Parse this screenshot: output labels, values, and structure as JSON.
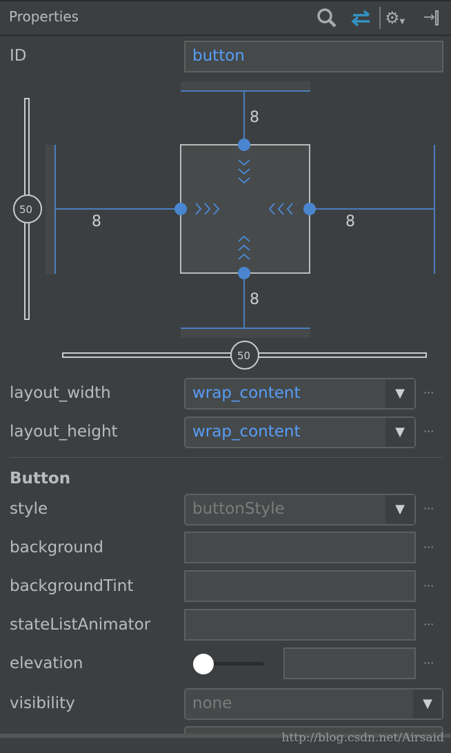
{
  "header": {
    "title": "Properties",
    "icons": [
      "search-icon",
      "swap-icon",
      "gear-icon",
      "pin-icon"
    ]
  },
  "id": {
    "label": "ID",
    "value": "button"
  },
  "constraints": {
    "top": "8",
    "bottom": "8",
    "left": "8",
    "right": "8",
    "vertical_bias": "50",
    "horizontal_bias": "50"
  },
  "layout": [
    {
      "label": "layout_width",
      "value": "wrap_content"
    },
    {
      "label": "layout_height",
      "value": "wrap_content"
    }
  ],
  "section": "Button",
  "props": {
    "style": {
      "label": "style",
      "value": "buttonStyle"
    },
    "background": {
      "label": "background",
      "value": ""
    },
    "backgroundTint": {
      "label": "backgroundTint",
      "value": ""
    },
    "stateListAnimator": {
      "label": "stateListAnimator",
      "value": ""
    },
    "elevation": {
      "label": "elevation",
      "value": "",
      "slider": 0
    },
    "visibility": {
      "label": "visibility",
      "value": "none"
    }
  },
  "more": "···",
  "watermark": "http://blog.csdn.net/Airsaid",
  "colors": {
    "accent": "#589df6",
    "bg": "#3c3f41"
  }
}
